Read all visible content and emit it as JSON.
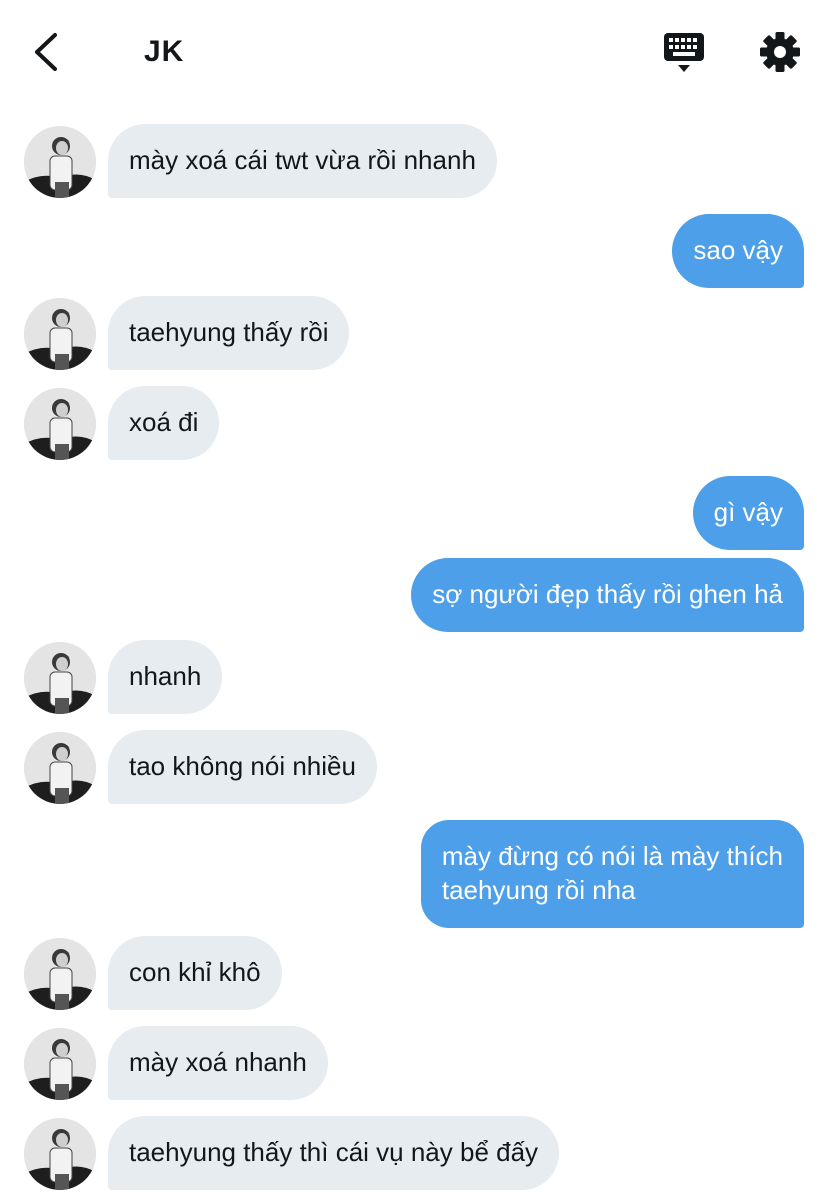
{
  "header": {
    "title": "JK"
  },
  "colors": {
    "incoming_bubble": "#e6ecf0",
    "outgoing_bubble": "#4c9fe8",
    "incoming_text": "#14171a",
    "outgoing_text": "#ffffff"
  },
  "icons": {
    "back": "chevron-left-icon",
    "keyboard": "keyboard-icon",
    "settings": "gear-icon"
  },
  "messages": [
    {
      "dir": "in",
      "text": "mày xoá cái twt vừa rồi nhanh"
    },
    {
      "dir": "out",
      "text": "sao vậy"
    },
    {
      "dir": "in",
      "text": "taehyung thấy rồi"
    },
    {
      "dir": "in",
      "text": "xoá đi"
    },
    {
      "dir": "out",
      "text": "gì vậy"
    },
    {
      "dir": "out",
      "text": "sợ người đẹp thấy rồi ghen hả"
    },
    {
      "dir": "in",
      "text": "nhanh"
    },
    {
      "dir": "in",
      "text": "tao không nói nhiều"
    },
    {
      "dir": "out",
      "text": "mày đừng có nói là mày thích\ntaehyung rồi nha"
    },
    {
      "dir": "in",
      "text": "con khỉ khô"
    },
    {
      "dir": "in",
      "text": "mày xoá nhanh"
    },
    {
      "dir": "in",
      "text": "taehyung thấy thì cái vụ này bể đấy"
    }
  ]
}
